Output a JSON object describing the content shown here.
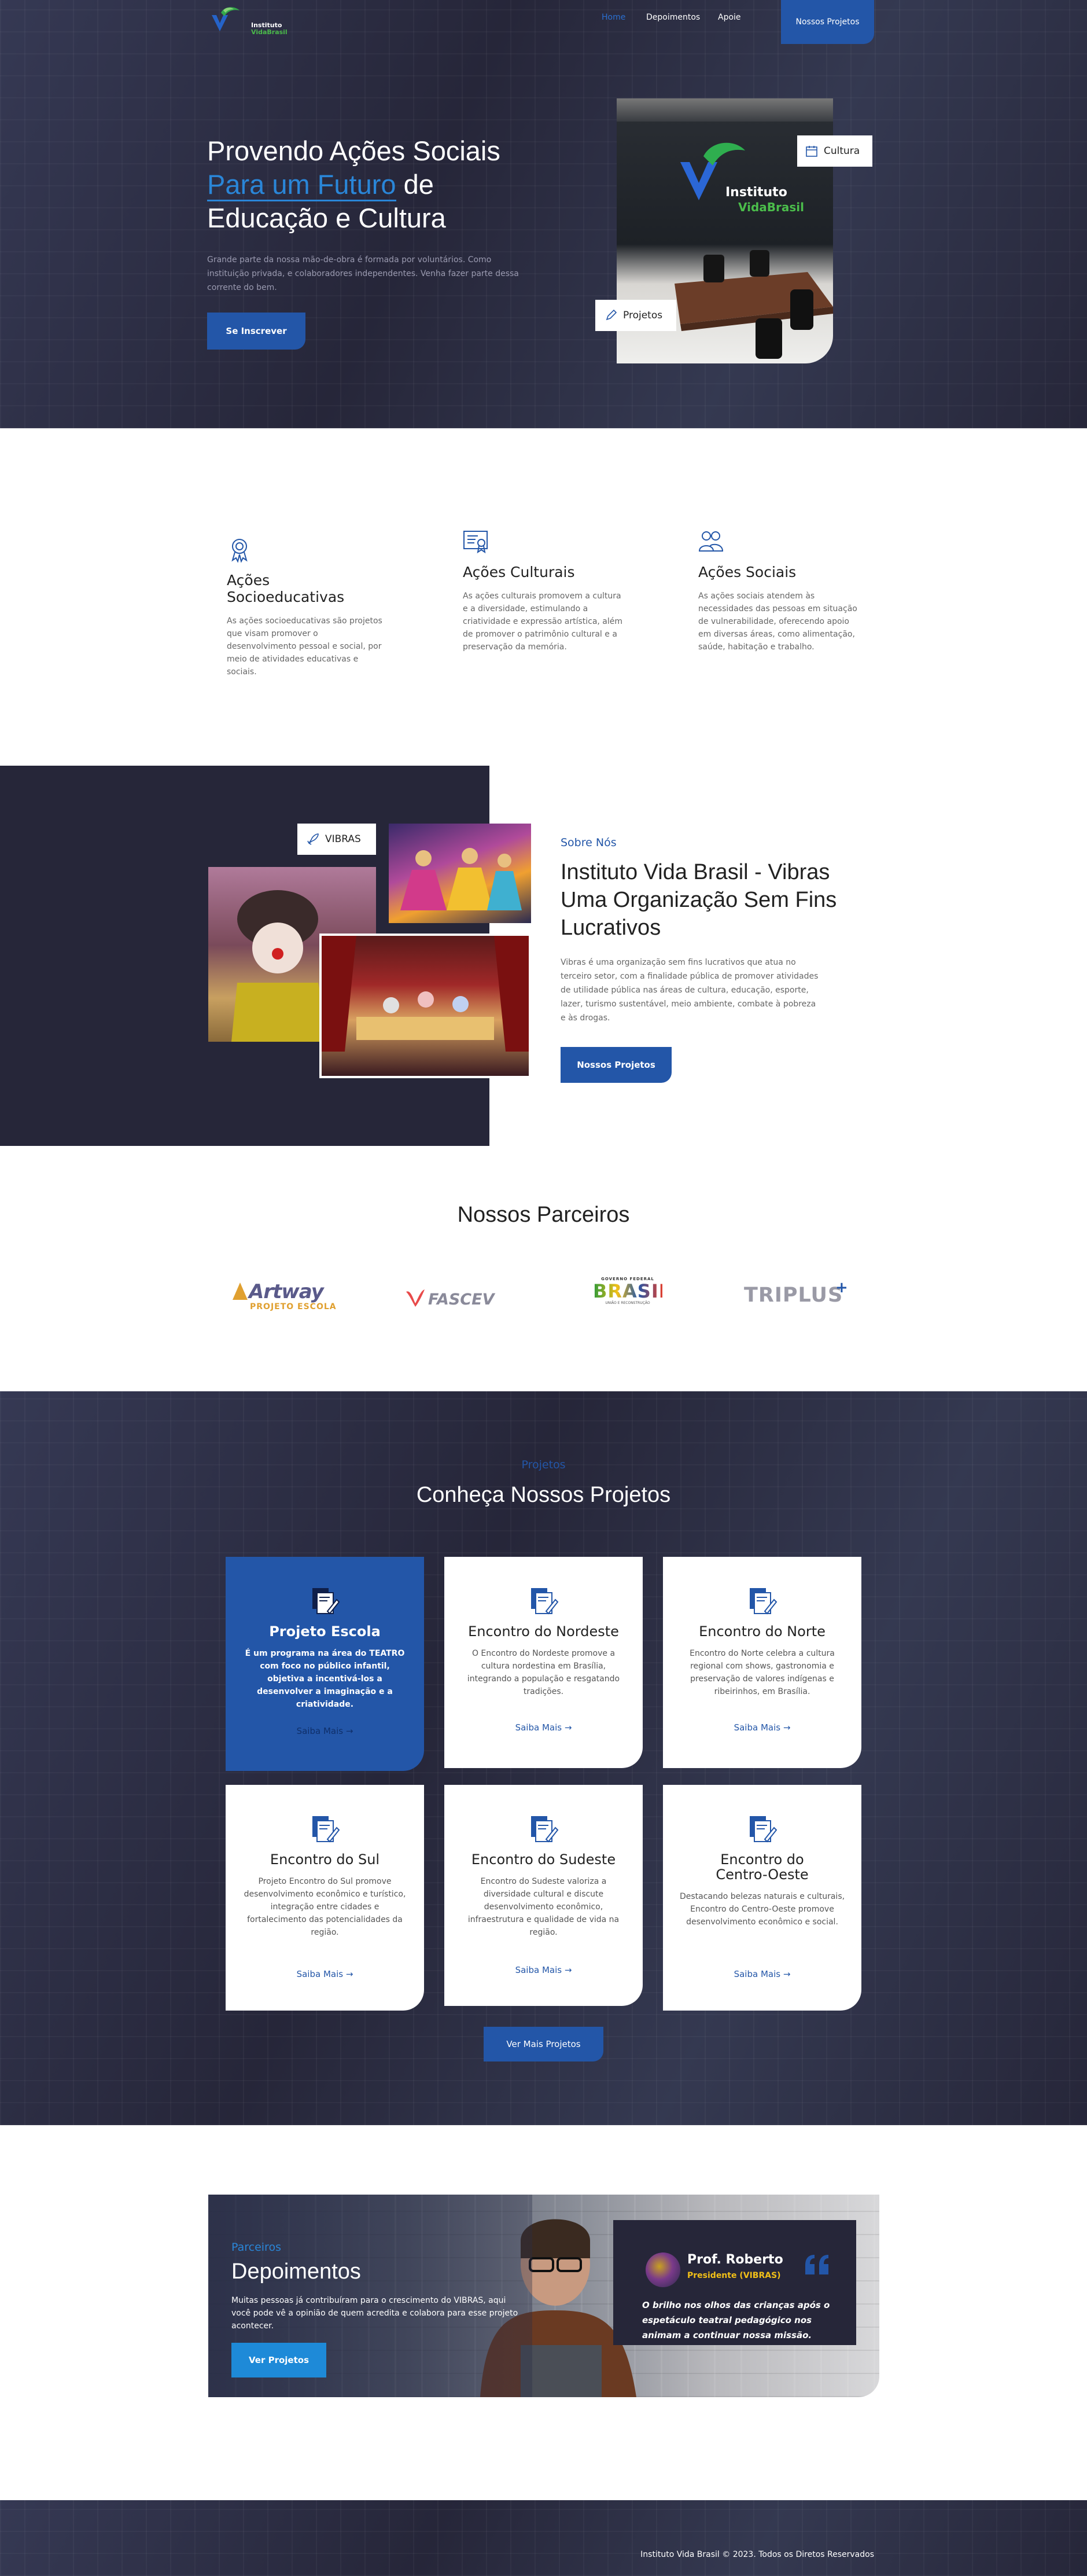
{
  "colors": {
    "dark": "#262639",
    "primary": "#2356a8",
    "accent": "#2a86d8",
    "white": "#ffffff"
  },
  "header": {
    "logo_line1": "Instituto",
    "logo_line2": "VidaBrasil",
    "nav": [
      "Home",
      "Depoimentos",
      "Apoie"
    ],
    "cta": "Nossos Projetos"
  },
  "hero": {
    "title_line1": "Provendo Ações Sociais",
    "title_highlight": "Para um Futuro",
    "title_rest": " de",
    "title_line3": "Educação e Cultura",
    "description": "Grande parte da nossa mão-de-obra é formada por voluntários. Como instituição privada, e colaboradores independentes. Venha fazer parte dessa corrente do bem.",
    "button": "Se Inscrever",
    "badge_culture": "Cultura",
    "badge_projects": "Projetos",
    "image_logo_line1": "Instituto",
    "image_logo_line2": "VidaBrasil"
  },
  "features": [
    {
      "icon": "award-icon",
      "title": "Ações Socioeducativas",
      "text": "As ações socioeducativas são projetos que visam promover o desenvolvimento pessoal e social, por meio de atividades educativas e sociais."
    },
    {
      "icon": "certificate-icon",
      "title": "Ações Culturais",
      "text": "As ações culturais promovem a cultura e a diversidade, estimulando a criatividade e expressão artística, além de promover o patrimônio cultural e a preservação da memória."
    },
    {
      "icon": "people-icon",
      "title": "Ações Sociais",
      "text": "As ações sociais atendem às necessidades das pessoas em situação de vulnerabilidade, oferecendo apoio em diversas áreas, como alimentação, saúde, habitação e trabalho."
    }
  ],
  "about": {
    "badge": "VIBRAS",
    "subtitle": "Sobre Nós",
    "title": "Instituto Vida Brasil - Vibras Uma Organização Sem Fins Lucrativos",
    "text": "Vibras é uma organização sem fins lucrativos que atua no terceiro setor, com a finalidade pública de promover atividades de utilidade pública nas áreas de cultura, educação, esporte, lazer, turismo sustentável, meio ambiente, combate à pobreza e às drogas.",
    "button": "Nossos Projetos"
  },
  "partners": {
    "title": "Nossos Parceiros",
    "logos": [
      {
        "name": "Artway",
        "line1": "Artway",
        "line2": "PROJETO ESCOLA"
      },
      {
        "name": "Fascev",
        "line1": "FASCEV"
      },
      {
        "name": "Brasil",
        "small": "GOVERNO FEDERAL",
        "line1": "BRASIL",
        "line2": "UNIÃO E RECONSTRUÇÃO"
      },
      {
        "name": "Triplus",
        "line1": "TRIPLUS"
      }
    ]
  },
  "projects": {
    "subtitle": "Projetos",
    "title": "Conheça Nossos Projetos",
    "more_label": "Saiba Mais",
    "button": "Ver Mais Projetos",
    "cards": [
      {
        "title": "Projeto Escola",
        "text": "É um programa na área do TEATRO com foco no público infantil, objetiva a incentivá-los a desenvolver a imaginação e a criatividade."
      },
      {
        "title": "Encontro do Nordeste",
        "text": "O Encontro do Nordeste promove a cultura nordestina em Brasília, integrando a população e resgatando tradições."
      },
      {
        "title": "Encontro do Norte",
        "text": "Encontro do Norte celebra a cultura regional com shows, gastronomia e preservação de valores indígenas e ribeirinhos, em Brasília."
      },
      {
        "title": "Encontro do Sul",
        "text": "Projeto Encontro do Sul promove desenvolvimento econômico e turístico, integração entre cidades e fortalecimento das potencialidades da região."
      },
      {
        "title": "Encontro do Sudeste",
        "text": "Encontro do Sudeste valoriza a diversidade cultural e discute desenvolvimento econômico, infraestrutura e qualidade de vida na região."
      },
      {
        "title": "Encontro do Centro-Oeste",
        "text": "Destacando belezas naturais e culturais, Encontro do Centro-Oeste promove desenvolvimento econômico e social."
      }
    ]
  },
  "testimonials": {
    "subtitle": "Parceiros",
    "title": "Depoimentos",
    "text": "Muitas pessoas já contribuíram para o crescimento do VIBRAS, aqui você pode vê a opinião de quem acredita e colabora para esse projeto acontecer.",
    "button": "Ver Projetos",
    "name": "Prof. Roberto",
    "role": "Presidente (VIBRAS)",
    "quote": "O brilho nos olhos das crianças após o espetáculo teatral pedagógico nos animam a continuar nossa missão."
  },
  "footer": {
    "copyright": "Instituto Vida Brasil © 2023. Todos os Diretos Reservados"
  }
}
